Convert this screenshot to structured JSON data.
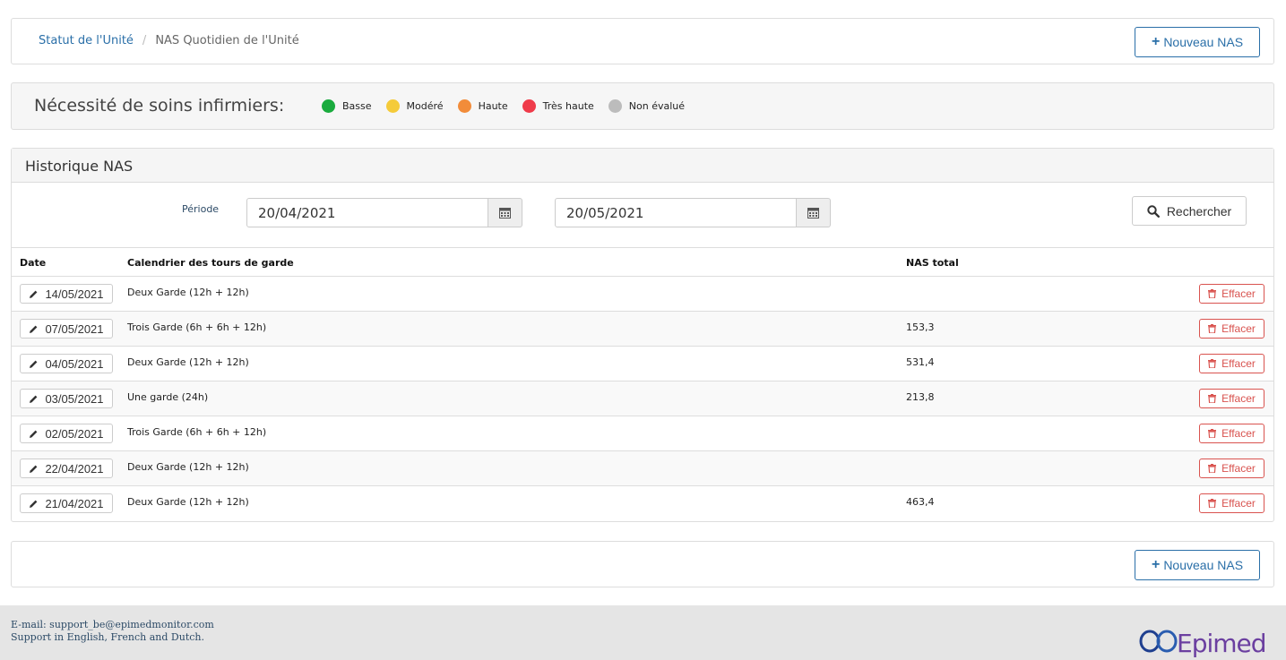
{
  "breadcrumb": {
    "parent": "Statut de l'Unité",
    "separator": "/",
    "current": "NAS Quotidien de l'Unité"
  },
  "new_button": {
    "label": "Nouveau NAS",
    "icon": "plus-icon"
  },
  "legend": {
    "title": "Nécessité de soins infirmiers:",
    "items": [
      {
        "label": "Basse",
        "color": "#1aab3e"
      },
      {
        "label": "Modéré",
        "color": "#f5cb3a"
      },
      {
        "label": "Haute",
        "color": "#f28c3a"
      },
      {
        "label": "Très haute",
        "color": "#ef3b4a"
      },
      {
        "label": "Non évalué",
        "color": "#bcbcbc"
      }
    ]
  },
  "history": {
    "title": "Historique NAS",
    "period_label": "Période",
    "date_from": "20/04/2021",
    "date_to": "20/05/2021",
    "search_label": "Rechercher",
    "columns": {
      "date": "Date",
      "schedule": "Calendrier des tours de garde",
      "nas_total": "NAS total"
    },
    "rows": [
      {
        "date": "14/05/2021",
        "schedule": "Deux Garde (12h + 12h)",
        "nas": ""
      },
      {
        "date": "07/05/2021",
        "schedule": "Trois Garde (6h + 6h + 12h)",
        "nas": "153,3"
      },
      {
        "date": "04/05/2021",
        "schedule": "Deux Garde (12h + 12h)",
        "nas": "531,4"
      },
      {
        "date": "03/05/2021",
        "schedule": "Une garde (24h)",
        "nas": "213,8"
      },
      {
        "date": "02/05/2021",
        "schedule": "Trois Garde (6h + 6h + 12h)",
        "nas": ""
      },
      {
        "date": "22/04/2021",
        "schedule": "Deux Garde (12h + 12h)",
        "nas": ""
      },
      {
        "date": "21/04/2021",
        "schedule": "Deux Garde (12h + 12h)",
        "nas": "463,4"
      }
    ],
    "delete_label": "Effacer"
  },
  "footer": {
    "email": "E-mail: support_be@epimedmonitor.com",
    "support": "Support in English, French and Dutch.",
    "logo_text": "Epimed",
    "brand_color": "#1f3f8f",
    "accent_color": "#6b3fa0"
  },
  "colors": {
    "link": "#2a6fa8",
    "danger": "#d9534f"
  }
}
